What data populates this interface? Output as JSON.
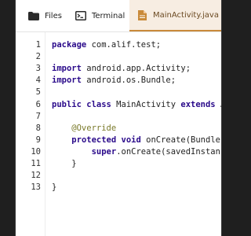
{
  "tabs": [
    {
      "label": "Files",
      "icon": "folder-icon"
    },
    {
      "label": "Terminal",
      "icon": "terminal-icon"
    },
    {
      "label": "MainActivity.java",
      "icon": "file-icon",
      "active": true
    }
  ],
  "colors": {
    "accent": "#c98a3a",
    "active_tab_bg": "#f7ede2",
    "keyword": "#2a0a8a",
    "annotation": "#7a7a2a"
  },
  "editor": {
    "line_numbers": [
      "1",
      "2",
      "3",
      "4",
      "5",
      "6",
      "7",
      "8",
      "9",
      "10",
      "11",
      "12",
      "13"
    ],
    "lines": [
      [
        {
          "t": "package",
          "c": "kw"
        },
        {
          "t": " com.alif.test;",
          "c": "plain"
        }
      ],
      [],
      [
        {
          "t": "import",
          "c": "kw"
        },
        {
          "t": " android.app.Activity;",
          "c": "plain"
        }
      ],
      [
        {
          "t": "import",
          "c": "kw"
        },
        {
          "t": " android.os.Bundle;",
          "c": "plain"
        }
      ],
      [],
      [
        {
          "t": "public class",
          "c": "kw"
        },
        {
          "t": " MainActivity ",
          "c": "plain"
        },
        {
          "t": "extends",
          "c": "kw"
        },
        {
          "t": " A",
          "c": "plain"
        }
      ],
      [],
      [
        {
          "t": "    @Override",
          "c": "ann"
        }
      ],
      [
        {
          "t": "    ",
          "c": "plain"
        },
        {
          "t": "protected void",
          "c": "kw"
        },
        {
          "t": " onCreate(Bundle",
          "c": "plain"
        }
      ],
      [
        {
          "t": "        ",
          "c": "plain"
        },
        {
          "t": "super",
          "c": "kw"
        },
        {
          "t": ".onCreate(savedInstanc",
          "c": "plain"
        }
      ],
      [
        {
          "t": "    }",
          "c": "plain"
        }
      ],
      [],
      [
        {
          "t": "}",
          "c": "plain"
        }
      ]
    ]
  }
}
